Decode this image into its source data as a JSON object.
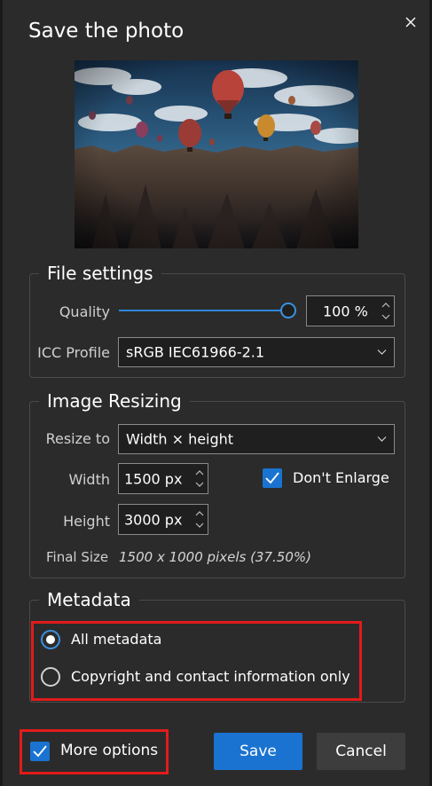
{
  "dialog": {
    "title": "Save the photo",
    "close_icon": "close-icon"
  },
  "colors": {
    "accent": "#1a73d1",
    "dialog_bg": "#2b2b2b",
    "highlight": "#e21b1b"
  },
  "file_settings": {
    "legend": "File settings",
    "quality_label": "Quality",
    "quality_value": "100 %",
    "quality_level": 1.0,
    "icc_label": "ICC Profile",
    "icc_value": "sRGB IEC61966-2.1"
  },
  "image_resizing": {
    "legend": "Image Resizing",
    "resize_label": "Resize to",
    "resize_value": "Width × height",
    "width_label": "Width",
    "width_value": "1500 px",
    "height_label": "Height",
    "height_value": "3000 px",
    "dont_enlarge_label": "Don't Enlarge",
    "dont_enlarge_checked": true,
    "final_size_label": "Final Size",
    "final_size_value": "1500 x 1000 pixels (37.50%)"
  },
  "metadata": {
    "legend": "Metadata",
    "options": [
      {
        "label": "All metadata",
        "selected": true
      },
      {
        "label": "Copyright and contact information only",
        "selected": false
      }
    ]
  },
  "footer": {
    "more_options_label": "More options",
    "more_options_checked": true,
    "save_label": "Save",
    "cancel_label": "Cancel"
  }
}
